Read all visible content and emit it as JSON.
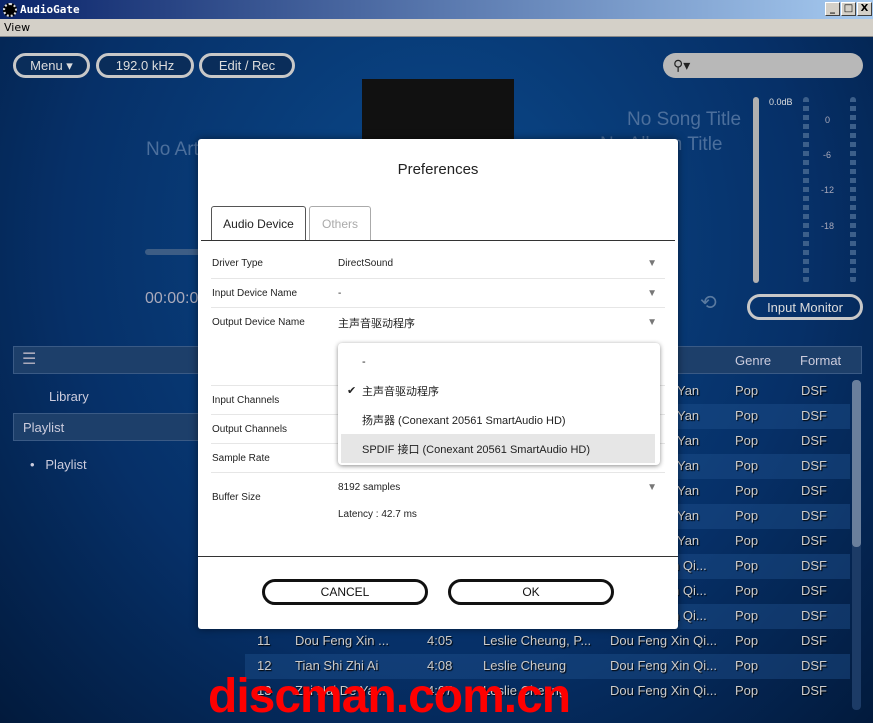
{
  "window": {
    "title": "AudioGate",
    "menu": [
      "View"
    ]
  },
  "toolbar": {
    "menu_label": "Menu ▾",
    "sample_rate": "192.0 kHz",
    "edit_label": "Edit / Rec",
    "search_placeholder": ""
  },
  "now_playing": {
    "artist": "No Artist",
    "song": "No Song Title",
    "album": "No Album Title",
    "time": "00:00:00"
  },
  "meter": {
    "peak": "0.0dB",
    "scale": [
      "0",
      "-6",
      "-12",
      "-18"
    ],
    "input_monitor": "Input Monitor"
  },
  "sidebar": {
    "items": [
      {
        "label": "Library"
      },
      {
        "label": "Playlist"
      },
      {
        "label": "Playlist"
      }
    ]
  },
  "table": {
    "headers": {
      "genre": "Genre",
      "format": "Format"
    },
    "rows": [
      {
        "album": "Yan",
        "genre": "Pop",
        "format": "DSF"
      },
      {
        "album": "Yan",
        "genre": "Pop",
        "format": "DSF"
      },
      {
        "album": "Yan",
        "genre": "Pop",
        "format": "DSF"
      },
      {
        "album": "Yan",
        "genre": "Pop",
        "format": "DSF"
      },
      {
        "album": "Yan",
        "genre": "Pop",
        "format": "DSF"
      },
      {
        "album": "Yan",
        "genre": "Pop",
        "format": "DSF"
      },
      {
        "album": "Yan",
        "genre": "Pop",
        "format": "DSF"
      },
      {
        "album": "n Qi...",
        "genre": "Pop",
        "format": "DSF"
      },
      {
        "album": "n Qi...",
        "genre": "Pop",
        "format": "DSF"
      },
      {
        "album": "n Qi...",
        "genre": "Pop",
        "format": "DSF"
      },
      {
        "num": "11",
        "title": "Dou Feng Xin ...",
        "time": "4:05",
        "artist": "Leslie Cheung, P...",
        "album": "Dou Feng Xin Qi...",
        "genre": "Pop",
        "format": "DSF"
      },
      {
        "num": "12",
        "title": "Tian Shi Zhi Ai",
        "time": "4:08",
        "artist": "Leslie Cheung",
        "album": "Dou Feng Xin Qi...",
        "genre": "Pop",
        "format": "DSF"
      },
      {
        "num": "13",
        "title": "Zai Nai De Ya...",
        "time": "4:07",
        "artist": "Leslie Cheung",
        "album": "Dou Feng Xin Qi...",
        "genre": "Pop",
        "format": "DSF"
      }
    ]
  },
  "preferences": {
    "title": "Preferences",
    "tabs": [
      "Audio Device",
      "Others"
    ],
    "rows": {
      "driver_type": {
        "label": "Driver Type",
        "value": "DirectSound"
      },
      "input_device": {
        "label": "Input Device Name",
        "value": "-"
      },
      "output_device": {
        "label": "Output Device Name",
        "value": "主声音驱动程序"
      },
      "input_channels": {
        "label": "Input Channels"
      },
      "output_channels": {
        "label": "Output Channels"
      },
      "sample_rate": {
        "label": "Sample Rate"
      },
      "buffer_size": {
        "label": "Buffer Size",
        "value": "8192 samples",
        "latency": "Latency : 42.7 ms"
      }
    },
    "dropdown_options": [
      "-",
      "主声音驱动程序",
      "扬声器 (Conexant 20561 SmartAudio HD)",
      "SPDIF 接口 (Conexant 20561 SmartAudio HD)"
    ],
    "selected_option": "主声音驱动程序",
    "cancel_label": "CANCEL",
    "ok_label": "OK"
  },
  "watermark": "discman.com.cn"
}
